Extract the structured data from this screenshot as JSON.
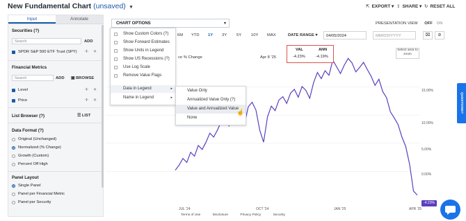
{
  "header": {
    "title": "New Fundamental Chart",
    "unsaved": "(unsaved)",
    "export_label": "EXPORT",
    "share_label": "SHARE",
    "reset_label": "RESET ALL"
  },
  "left_panel": {
    "tabs": [
      "Input",
      "Annotate"
    ],
    "securities_heading": "Securities (?)",
    "search_placeholder": "Search",
    "add_label": "ADD",
    "security_item": "SPDR S&P 500 ETF Trust (SPY)",
    "financial_metrics_heading": "Financial Metrics",
    "browse_label": "BROWSE",
    "metric_items": [
      "Level",
      "Price"
    ],
    "list_browser_heading": "List Browser (?)",
    "list_label": "LIST",
    "data_format_heading": "Data Format (?)",
    "data_format_options": [
      "Original (Unchanged)",
      "Normalized (% Change)",
      "Growth (Custom)",
      "Percent Off High"
    ],
    "data_format_selected": 1,
    "panel_layout_heading": "Panel Layout",
    "panel_layout_options": [
      "Single Panel",
      "Panel per Financial Metric",
      "Panel per Security"
    ],
    "panel_layout_selected": 0
  },
  "chart_options": {
    "label": "CHART OPTIONS",
    "items": [
      {
        "label": "Show Custom Colors (?)",
        "submenu": false
      },
      {
        "label": "Show Forward Estimates",
        "submenu": false
      },
      {
        "label": "Show Units in Legend",
        "submenu": false
      },
      {
        "label": "Show US Recessions (?)",
        "submenu": false
      },
      {
        "label": "Use Log Scale",
        "submenu": false
      },
      {
        "label": "Remove Value Flags",
        "submenu": false
      },
      {
        "label": "Data in Legend",
        "submenu": true
      },
      {
        "label": "Name in Legend",
        "submenu": true
      }
    ],
    "submenu_items": [
      "Value Only",
      "Annualized Value Only (?)",
      "Value and Annualized Value",
      "None"
    ],
    "submenu_hover_index": 2
  },
  "toolbar": {
    "ranges": [
      "6M",
      "YTD",
      "1Y",
      "3Y",
      "5Y",
      "10Y",
      "MAX"
    ],
    "active_range": "1Y",
    "date_range_label": "DATE RANGE",
    "start_date": "04/05/2024",
    "end_date_placeholder": "MM/DD/YYYY",
    "presentation_view": "PRESENTATION VIEW",
    "toggle_off": "OFF",
    "toggle_on": "ON"
  },
  "legend": {
    "partial_label": "ce % Change",
    "date": "Apr 8 '25",
    "val_header": "VAL",
    "ann_header": "ANN",
    "val": "-4.23%",
    "ann": "-4.19%"
  },
  "zoom_label": "Select area to zoom",
  "flag_value": "-4.23%",
  "colors": {
    "accent": "#1a5aa8",
    "series": "#5b3fbf",
    "highlight_border": "#d9534f",
    "help_tab": "#1a73e8"
  },
  "chart_data": {
    "type": "line",
    "x_ticks": [
      "JUL '24",
      "OCT '24",
      "JAN '25",
      "APR '25"
    ],
    "y_ticks": [
      "15.00%",
      "10.00%",
      "5.00%",
      "0.00%"
    ],
    "ylim": [
      -6,
      21
    ],
    "series": [
      {
        "x": [
          0,
          4,
          8,
          12,
          16,
          20,
          24,
          28,
          32,
          36,
          40,
          44,
          48,
          52,
          56,
          60,
          64,
          68,
          72,
          76,
          80,
          84,
          88,
          92,
          96,
          100,
          104,
          108,
          112,
          116,
          120,
          124,
          128,
          132,
          136,
          140,
          144,
          148,
          152,
          156,
          160,
          164,
          168,
          172,
          176,
          180,
          184,
          188,
          192,
          196,
          200,
          204,
          208,
          212,
          216,
          220,
          224,
          228,
          232,
          236,
          240,
          244,
          248,
          252
        ],
        "y": [
          0.2,
          1.1,
          2.3,
          1.6,
          3.4,
          2.7,
          4.6,
          3.9,
          5.2,
          6.8,
          6.1,
          7.4,
          8.9,
          9.6,
          8.1,
          10.4,
          11.2,
          9.8,
          8.4,
          11.5,
          12.3,
          10.9,
          7.3,
          5.2,
          9.7,
          11.6,
          10.8,
          12.7,
          13.3,
          12.1,
          13.9,
          14.6,
          13.2,
          15.1,
          14.4,
          13.0,
          15.8,
          17.6,
          16.5,
          17.9,
          17.1,
          19.8,
          18.6,
          17.4,
          18.9,
          20.1,
          19.3,
          17.7,
          18.5,
          19.4,
          18.1,
          16.9,
          15.3,
          16.4,
          14.2,
          13.1,
          10.6,
          9.5,
          8.3,
          6.1,
          4.4,
          1.2,
          -3.5,
          -4.23
        ]
      }
    ]
  },
  "footer": [
    "Terms of Use",
    "Disclosure",
    "Privacy Policy",
    "Security"
  ],
  "questions_label": "QUESTIONS?"
}
